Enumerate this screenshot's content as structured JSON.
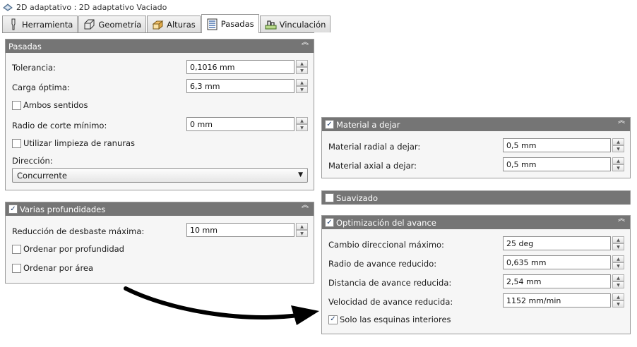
{
  "window": {
    "title": "2D adaptativo : 2D adaptativo Vaciado"
  },
  "tabs": [
    {
      "label": "Herramienta",
      "icon": "tool-icon"
    },
    {
      "label": "Geometría",
      "icon": "geometry-icon"
    },
    {
      "label": "Alturas",
      "icon": "heights-icon"
    },
    {
      "label": "Pasadas",
      "icon": "passes-icon",
      "active": true
    },
    {
      "label": "Vinculación",
      "icon": "linking-icon"
    }
  ],
  "pasadas": {
    "title": "Pasadas",
    "tolerancia_label": "Tolerancia:",
    "tolerancia_value": "0,1016 mm",
    "carga_label": "Carga óptima:",
    "carga_value": "6,3 mm",
    "ambos_label": "Ambos sentidos",
    "ambos_checked": false,
    "radio_label": "Radio de corte mínimo:",
    "radio_value": "0 mm",
    "limpieza_label": "Utilizar limpieza de ranuras",
    "limpieza_checked": false,
    "direccion_label": "Dirección:",
    "direccion_value": "Concurrente"
  },
  "profundidades": {
    "title": "Varias profundidades",
    "checked": true,
    "reduccion_label": "Reducción de desbaste máxima:",
    "reduccion_value": "10 mm",
    "ordenar_prof_label": "Ordenar por profundidad",
    "ordenar_prof_checked": false,
    "ordenar_area_label": "Ordenar por área",
    "ordenar_area_checked": false
  },
  "material": {
    "title": "Material a dejar",
    "checked": true,
    "radial_label": "Material radial a dejar:",
    "radial_value": "0,5 mm",
    "axial_label": "Material axial a dejar:",
    "axial_value": "0,5 mm"
  },
  "suavizado": {
    "title": "Suavizado",
    "checked": false
  },
  "optimizacion": {
    "title": "Optimización del avance",
    "checked": true,
    "cambio_label": "Cambio direccional máximo:",
    "cambio_value": "25 deg",
    "radio_label": "Radio de avance reducido:",
    "radio_value": "0,635 mm",
    "distancia_label": "Distancia de avance reducida:",
    "distancia_value": "2,54 mm",
    "velocidad_label": "Velocidad de avance reducida:",
    "velocidad_value": "1152 mm/min",
    "esquinas_label": "Solo las esquinas interiores",
    "esquinas_checked": true
  },
  "colors": {
    "header_bg": "#757575",
    "panel_bg": "#f6f6f6",
    "arrow": "#000000"
  }
}
